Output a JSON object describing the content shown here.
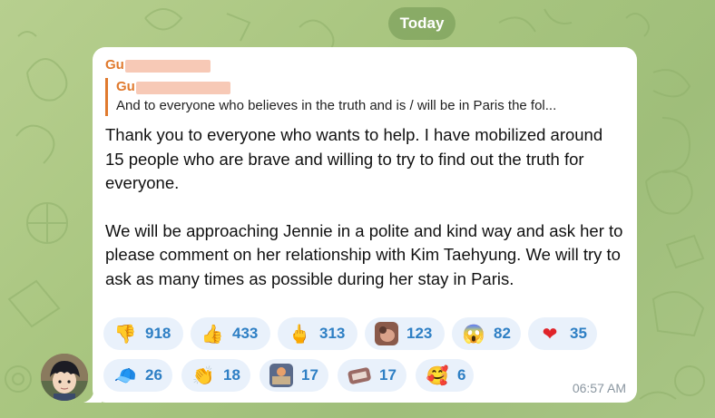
{
  "date_label": "Today",
  "message": {
    "sender": "Gu",
    "reply": {
      "name": "Gu",
      "text": "And to everyone who believes in the truth and is / will be in Paris the fol..."
    },
    "paragraphs": [
      "Thank you to everyone who wants to help. I have mobilized around 15 people who are brave and willing to try to find out the truth for everyone.",
      "We will be approaching Jennie in a polite and kind way and ask her to please comment on her relationship with Kim Taehyung. We will try to ask as many times as possible during her stay in Paris."
    ],
    "time": "06:57 AM",
    "reactions": [
      {
        "icon": "thumbs-down",
        "count": "918"
      },
      {
        "icon": "thumbs-up",
        "count": "433"
      },
      {
        "icon": "middle-finger",
        "count": "313"
      },
      {
        "icon": "custom-sticker-1",
        "count": "123"
      },
      {
        "icon": "screaming-face",
        "count": "82"
      },
      {
        "icon": "red-heart",
        "count": "35"
      },
      {
        "icon": "blue-cap",
        "count": "26"
      },
      {
        "icon": "clapping-hands",
        "count": "18"
      },
      {
        "icon": "custom-sticker-2",
        "count": "17"
      },
      {
        "icon": "custom-sticker-3",
        "count": "17"
      },
      {
        "icon": "smiling-face-with-hearts",
        "count": "6"
      }
    ]
  },
  "colors": {
    "accent_name": "#e07a2e",
    "reaction_count": "#2e7fc4",
    "reaction_bg": "#e9f1fb"
  }
}
